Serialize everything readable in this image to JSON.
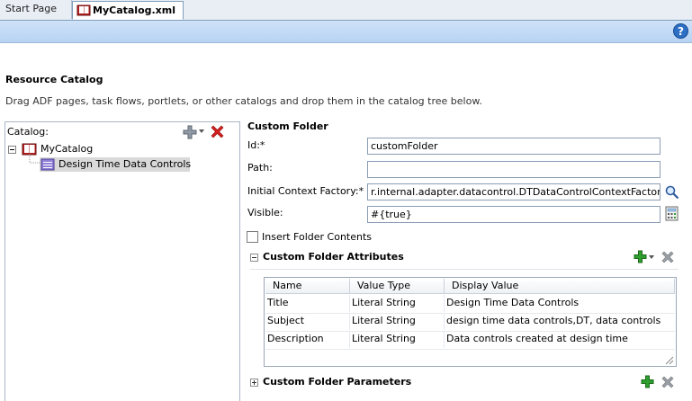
{
  "tabs": [
    {
      "label": "Start Page",
      "active": false
    },
    {
      "label": "MyCatalog.xml",
      "active": true
    }
  ],
  "help_icon": "help-icon",
  "page": {
    "title": "Resource Catalog",
    "description": "Drag ADF pages, task flows, portlets, or other catalogs and drop them in the catalog tree below."
  },
  "catalog": {
    "label": "Catalog:",
    "root": {
      "label": "MyCatalog",
      "icon": "book-icon"
    },
    "children": [
      {
        "label": "Design Time Data Controls",
        "icon": "folder-icon",
        "selected": true
      }
    ]
  },
  "form": {
    "section_title": "Custom Folder",
    "id_label": "Id:*",
    "id_value": "customFolder",
    "path_label": "Path:",
    "path_value": "",
    "context_label": "Initial Context Factory:*",
    "context_value": "r.internal.adapter.datacontrol.DTDataControlContextFactory",
    "visible_label": "Visible:",
    "visible_value": "#{true}",
    "insert_label": "Insert Folder Contents",
    "insert_checked": false
  },
  "attributes": {
    "title": "Custom Folder Attributes",
    "expanded": true,
    "columns": [
      "Name",
      "Value Type",
      "Display Value"
    ],
    "rows": [
      [
        "Title",
        "Literal String",
        "Design Time Data Controls"
      ],
      [
        "Subject",
        "Literal String",
        "design time data controls,DT, data controls"
      ],
      [
        "Description",
        "Literal String",
        "Data controls created at design time"
      ]
    ]
  },
  "parameters": {
    "title": "Custom Folder Parameters",
    "expanded": false
  },
  "colors": {
    "accent_band": "#cfe2f8",
    "add_green": "#2f9e2f",
    "delete_red": "#d42020",
    "selection": "#d9d9d9"
  }
}
